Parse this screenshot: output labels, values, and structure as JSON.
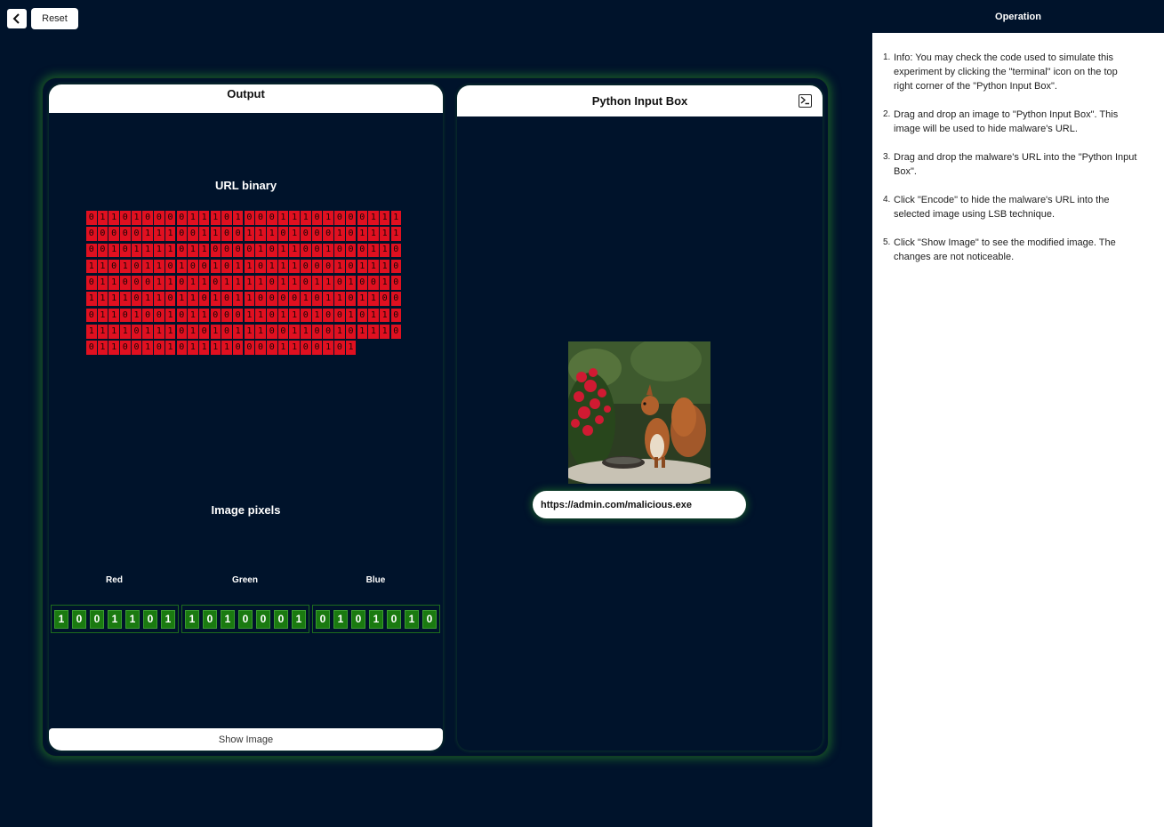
{
  "top": {
    "reset_label": "Reset"
  },
  "output": {
    "title": "Output",
    "url_binary_title": "URL binary",
    "url_binary": "01101000011101000111010001110000011100110011101000101111001011110110000101100100011011010110100101101110001011100110001101101111011011010010111101101101011000010110110001101001011000110110100101101111011101010111001100101110011001010111100001100101",
    "image_pixels_title": "Image pixels",
    "channels": [
      {
        "label": "Red",
        "bits": [
          "1",
          "0",
          "0",
          "1",
          "1",
          "0",
          "1"
        ]
      },
      {
        "label": "Green",
        "bits": [
          "1",
          "0",
          "1",
          "0",
          "0",
          "0",
          "1"
        ]
      },
      {
        "label": "Blue",
        "bits": [
          "0",
          "1",
          "0",
          "1",
          "0",
          "1",
          "0"
        ]
      }
    ],
    "show_image_label": "Show Image"
  },
  "input": {
    "title": "Python Input Box",
    "terminal_icon": "terminal-icon",
    "url_value": "https://admin.com/malicious.exe"
  },
  "sidebar": {
    "title": "Operation",
    "steps": [
      {
        "num": "1.",
        "text": "Info: You may check the code used to simulate this experiment by clicking the \"terminal\" icon on the top right corner of the \"Python Input Box\"."
      },
      {
        "num": "2.",
        "text": "Drag and drop an image to \"Python Input Box\". This image will be used to hide malware's URL."
      },
      {
        "num": "3.",
        "text": "Drag and drop the malware's URL into the \"Python Input Box\"."
      },
      {
        "num": "4.",
        "text": "Click \"Encode\" to hide the malware's URL into the selected image using LSB technique."
      },
      {
        "num": "5.",
        "text": "Click \"Show Image\" to see the modified image. The changes are not noticeable."
      }
    ]
  },
  "colors": {
    "background": "#00132b",
    "bit_red": "#e01020",
    "pixel_green": "#1a7a10",
    "glow": "#288c28"
  }
}
